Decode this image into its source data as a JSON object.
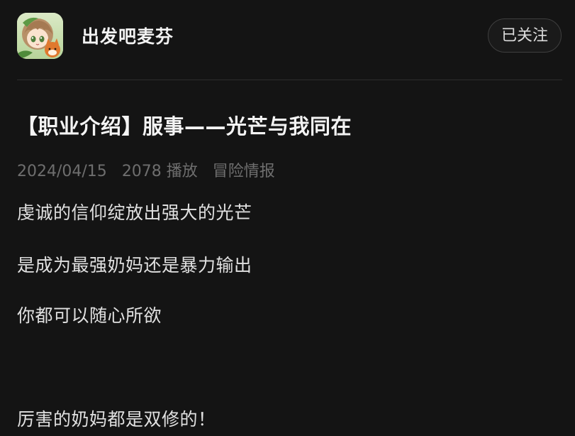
{
  "channel": {
    "name": "出发吧麦芬",
    "follow_label": "已关注",
    "avatar_icon": "game-character-avatar-icon"
  },
  "post": {
    "title": "【职业介绍】服事——光芒与我同在",
    "meta": {
      "date": "2024/04/15",
      "plays": "2078 播放",
      "tag": "冒险情报"
    },
    "paragraphs": [
      "虔诚的信仰绽放出强大的光芒",
      "是成为最强奶妈还是暴力输出",
      "你都可以随心所欲",
      "厉害的奶妈都是双修的！"
    ]
  },
  "colors": {
    "background": "#141414",
    "text_primary": "#f4f4f4",
    "text_meta": "#6e6e6e",
    "divider": "#2e2e2e"
  }
}
